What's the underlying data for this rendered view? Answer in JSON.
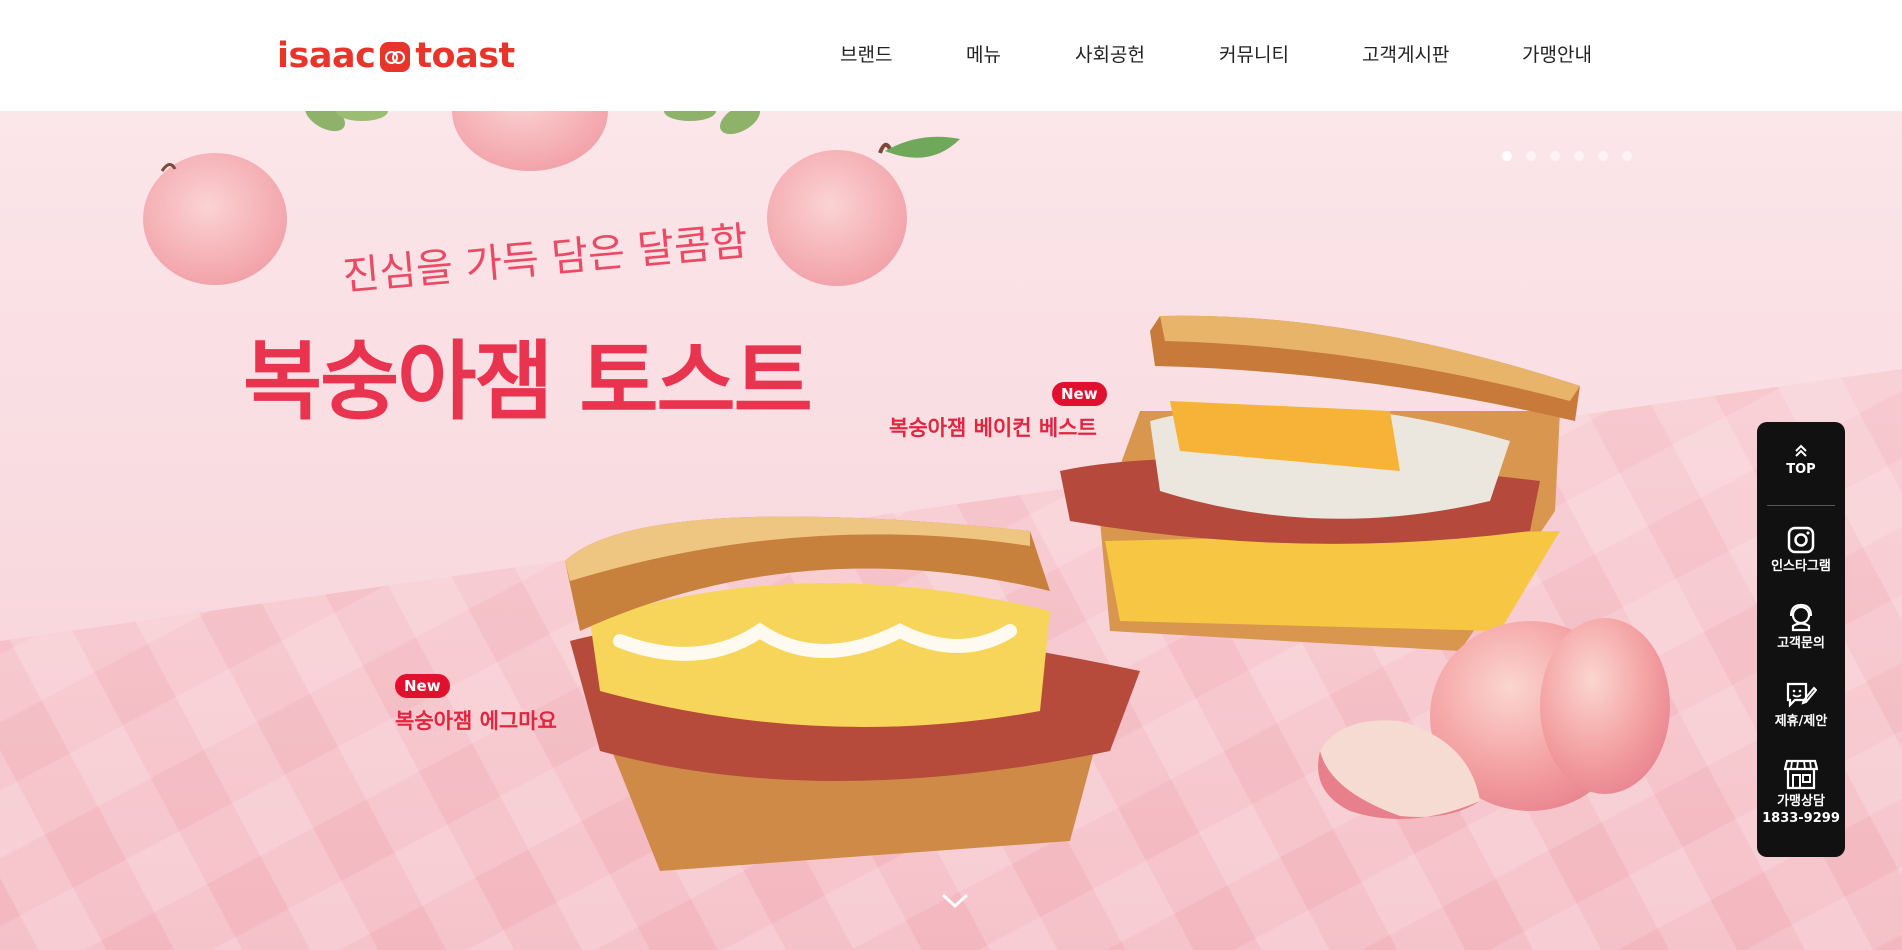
{
  "header": {
    "logo": {
      "left": "isaac",
      "right": "toast"
    },
    "nav": [
      {
        "label": "브랜드"
      },
      {
        "label": "메뉴"
      },
      {
        "label": "사회공헌"
      },
      {
        "label": "커뮤니티"
      },
      {
        "label": "고객게시판"
      },
      {
        "label": "가맹안내"
      }
    ]
  },
  "hero": {
    "tagline": "진심을 가득 담은 달콤함",
    "headline": "복숭아잼 토스트",
    "products": [
      {
        "badge": "New",
        "name": "복숭아잼 베이컨 베스트"
      },
      {
        "badge": "New",
        "name": "복숭아잼 에그마요"
      }
    ],
    "slide_count": 6,
    "active_slide": 1
  },
  "quick_menu": {
    "top": "TOP",
    "instagram": "인스타그램",
    "customer": "고객문의",
    "partner": "제휴/제안",
    "franchise": "가맹상담",
    "phone": "1833-9299"
  },
  "colors": {
    "brand": "#e8342b",
    "headline": "#e8344f",
    "badge": "#e0102f",
    "hero_bg": "#f9dde2",
    "quick_menu_bg": "#111111"
  },
  "icons": [
    "logo-face-icon",
    "chevron-up-icon",
    "instagram-icon",
    "headset-icon",
    "chat-edit-icon",
    "store-icon",
    "chevron-down-icon"
  ]
}
